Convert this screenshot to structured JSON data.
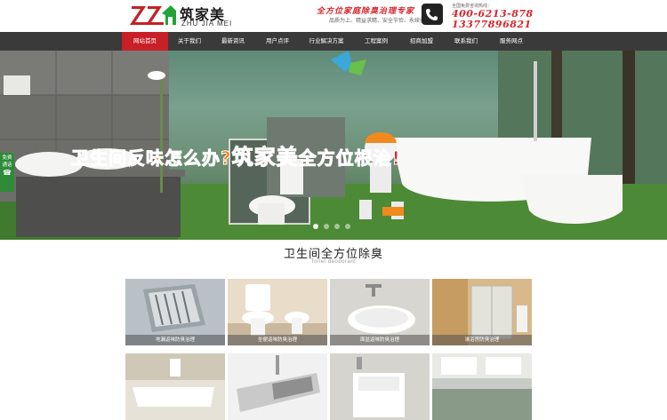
{
  "brand": {
    "name_cn": "筑家美",
    "name_en": "ZHU JIA MEI",
    "slogan": "全方位家庭除臭治理专家",
    "subslogan": "品质为上、精益求精、安全节俭、永续创新",
    "hotline_caption": "全国免费咨询热线：",
    "hotline_1": "400-6213-878",
    "hotline_2": "13377896821"
  },
  "nav": {
    "items": [
      {
        "label": "网站首页",
        "active": true
      },
      {
        "label": "关于我们"
      },
      {
        "label": "最新资讯"
      },
      {
        "label": "用户点评"
      },
      {
        "label": "行业解决方案"
      },
      {
        "label": "工程案例"
      },
      {
        "label": "招商加盟"
      },
      {
        "label": "联系我们"
      },
      {
        "label": "服务网点"
      }
    ]
  },
  "banner": {
    "part1": "卫生间反味怎么办?",
    "part2": "筑家美",
    "part3": "全方位根治!"
  },
  "side_tab": {
    "line1": "免费",
    "line2": "通话"
  },
  "section": {
    "title": "卫生间全方位除臭",
    "subtitle": "Toilet deodorant"
  },
  "products": [
    {
      "caption": "地漏返味防臭治理"
    },
    {
      "caption": "坐便返味防臭治理"
    },
    {
      "caption": "面盆返味防臭治理"
    },
    {
      "caption": "淋浴房防臭治理"
    },
    {
      "caption": ""
    },
    {
      "caption": ""
    },
    {
      "caption": ""
    },
    {
      "caption": ""
    }
  ],
  "colors": {
    "brand_red": "#d8262b",
    "nav_bg": "#3a3a3a",
    "nav_active": "#c72026",
    "brand_green": "#22a33a",
    "brand_orange": "#ff7a12"
  }
}
